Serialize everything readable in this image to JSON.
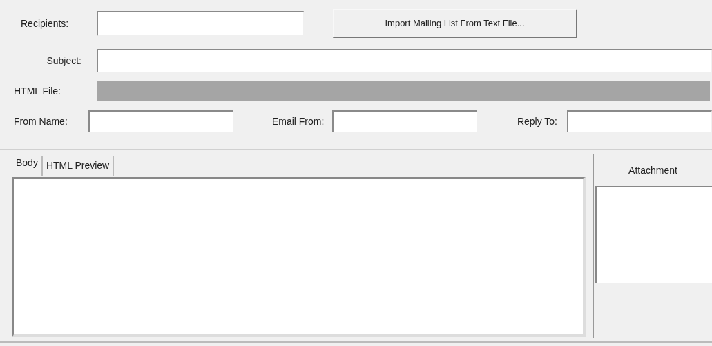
{
  "recipients": {
    "label": "Recipients:"
  },
  "import_button": {
    "label": "Import Mailing List From Text File..."
  },
  "subject": {
    "label": "Subject:"
  },
  "html_file": {
    "label": "HTML File:",
    "disabled": true
  },
  "from_name": {
    "label": "From Name:"
  },
  "email_from": {
    "label": "Email From:"
  },
  "reply_to": {
    "label": "Reply To:"
  },
  "tabs": [
    {
      "label": "Body",
      "selected": true
    },
    {
      "label": "HTML Preview",
      "selected": false
    }
  ],
  "attachment": {
    "title": "Attachment"
  }
}
